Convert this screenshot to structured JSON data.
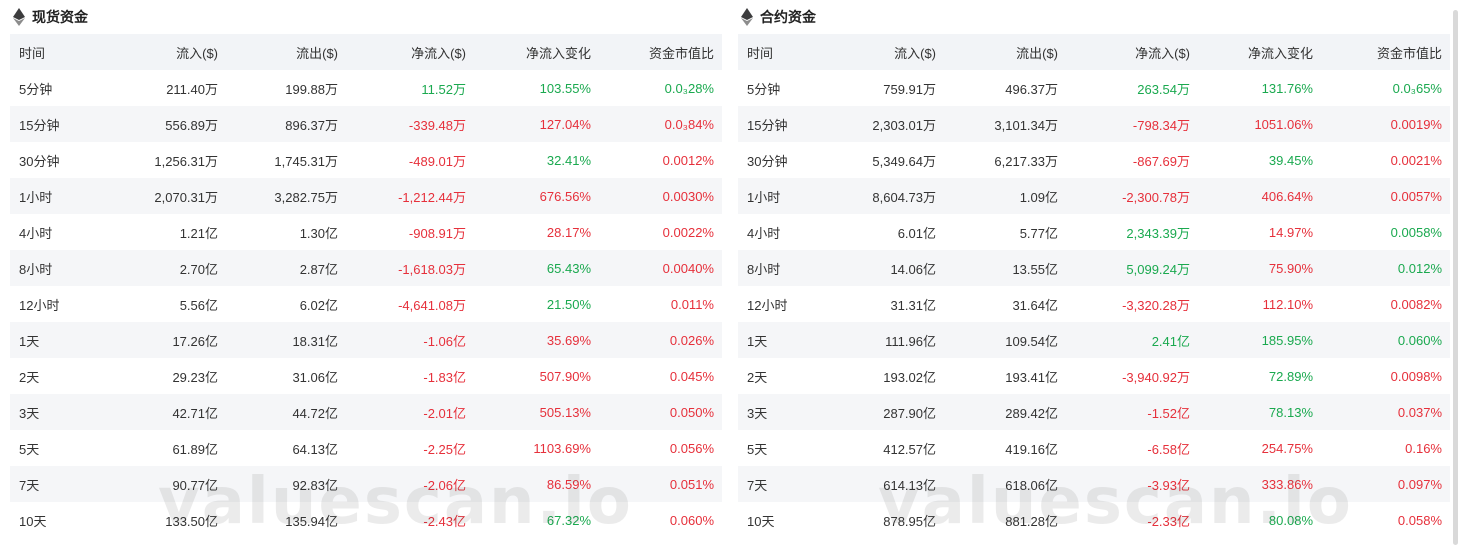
{
  "colors": {
    "positive": "#1aa94f",
    "negative": "#e6303b",
    "header_bg": "#f2f4f7"
  },
  "watermark": "valuescan.io",
  "columns": [
    "时间",
    "流入($)",
    "流出($)",
    "净流入($)",
    "净流入变化",
    "资金市值比"
  ],
  "spot": {
    "title": "现货资金",
    "icon": "ethereum-icon",
    "rows": [
      {
        "t": "5分钟",
        "in": "211.40万",
        "out": "199.88万",
        "net": "11.52万",
        "net_s": "pos",
        "chg": "103.55%",
        "chg_s": "pos",
        "ratio": "0.0₃28%",
        "ratio_s": "pos"
      },
      {
        "t": "15分钟",
        "in": "556.89万",
        "out": "896.37万",
        "net": "-339.48万",
        "net_s": "neg",
        "chg": "127.04%",
        "chg_s": "neg",
        "ratio": "0.0₃84%",
        "ratio_s": "neg"
      },
      {
        "t": "30分钟",
        "in": "1,256.31万",
        "out": "1,745.31万",
        "net": "-489.01万",
        "net_s": "neg",
        "chg": "32.41%",
        "chg_s": "pos",
        "ratio": "0.0012%",
        "ratio_s": "neg"
      },
      {
        "t": "1小时",
        "in": "2,070.31万",
        "out": "3,282.75万",
        "net": "-1,212.44万",
        "net_s": "neg",
        "chg": "676.56%",
        "chg_s": "neg",
        "ratio": "0.0030%",
        "ratio_s": "neg"
      },
      {
        "t": "4小时",
        "in": "1.21亿",
        "out": "1.30亿",
        "net": "-908.91万",
        "net_s": "neg",
        "chg": "28.17%",
        "chg_s": "neg",
        "ratio": "0.0022%",
        "ratio_s": "neg"
      },
      {
        "t": "8小时",
        "in": "2.70亿",
        "out": "2.87亿",
        "net": "-1,618.03万",
        "net_s": "neg",
        "chg": "65.43%",
        "chg_s": "pos",
        "ratio": "0.0040%",
        "ratio_s": "neg"
      },
      {
        "t": "12小时",
        "in": "5.56亿",
        "out": "6.02亿",
        "net": "-4,641.08万",
        "net_s": "neg",
        "chg": "21.50%",
        "chg_s": "pos",
        "ratio": "0.011%",
        "ratio_s": "neg"
      },
      {
        "t": "1天",
        "in": "17.26亿",
        "out": "18.31亿",
        "net": "-1.06亿",
        "net_s": "neg",
        "chg": "35.69%",
        "chg_s": "neg",
        "ratio": "0.026%",
        "ratio_s": "neg"
      },
      {
        "t": "2天",
        "in": "29.23亿",
        "out": "31.06亿",
        "net": "-1.83亿",
        "net_s": "neg",
        "chg": "507.90%",
        "chg_s": "neg",
        "ratio": "0.045%",
        "ratio_s": "neg"
      },
      {
        "t": "3天",
        "in": "42.71亿",
        "out": "44.72亿",
        "net": "-2.01亿",
        "net_s": "neg",
        "chg": "505.13%",
        "chg_s": "neg",
        "ratio": "0.050%",
        "ratio_s": "neg"
      },
      {
        "t": "5天",
        "in": "61.89亿",
        "out": "64.13亿",
        "net": "-2.25亿",
        "net_s": "neg",
        "chg": "1103.69%",
        "chg_s": "neg",
        "ratio": "0.056%",
        "ratio_s": "neg"
      },
      {
        "t": "7天",
        "in": "90.77亿",
        "out": "92.83亿",
        "net": "-2.06亿",
        "net_s": "neg",
        "chg": "86.59%",
        "chg_s": "neg",
        "ratio": "0.051%",
        "ratio_s": "neg"
      },
      {
        "t": "10天",
        "in": "133.50亿",
        "out": "135.94亿",
        "net": "-2.43亿",
        "net_s": "neg",
        "chg": "67.32%",
        "chg_s": "pos",
        "ratio": "0.060%",
        "ratio_s": "neg"
      }
    ]
  },
  "futures": {
    "title": "合约资金",
    "icon": "ethereum-icon",
    "rows": [
      {
        "t": "5分钟",
        "in": "759.91万",
        "out": "496.37万",
        "net": "263.54万",
        "net_s": "pos",
        "chg": "131.76%",
        "chg_s": "pos",
        "ratio": "0.0₃65%",
        "ratio_s": "pos"
      },
      {
        "t": "15分钟",
        "in": "2,303.01万",
        "out": "3,101.34万",
        "net": "-798.34万",
        "net_s": "neg",
        "chg": "1051.06%",
        "chg_s": "neg",
        "ratio": "0.0019%",
        "ratio_s": "neg"
      },
      {
        "t": "30分钟",
        "in": "5,349.64万",
        "out": "6,217.33万",
        "net": "-867.69万",
        "net_s": "neg",
        "chg": "39.45%",
        "chg_s": "pos",
        "ratio": "0.0021%",
        "ratio_s": "neg"
      },
      {
        "t": "1小时",
        "in": "8,604.73万",
        "out": "1.09亿",
        "net": "-2,300.78万",
        "net_s": "neg",
        "chg": "406.64%",
        "chg_s": "neg",
        "ratio": "0.0057%",
        "ratio_s": "neg"
      },
      {
        "t": "4小时",
        "in": "6.01亿",
        "out": "5.77亿",
        "net": "2,343.39万",
        "net_s": "pos",
        "chg": "14.97%",
        "chg_s": "neg",
        "ratio": "0.0058%",
        "ratio_s": "pos"
      },
      {
        "t": "8小时",
        "in": "14.06亿",
        "out": "13.55亿",
        "net": "5,099.24万",
        "net_s": "pos",
        "chg": "75.90%",
        "chg_s": "neg",
        "ratio": "0.012%",
        "ratio_s": "pos"
      },
      {
        "t": "12小时",
        "in": "31.31亿",
        "out": "31.64亿",
        "net": "-3,320.28万",
        "net_s": "neg",
        "chg": "112.10%",
        "chg_s": "neg",
        "ratio": "0.0082%",
        "ratio_s": "neg"
      },
      {
        "t": "1天",
        "in": "111.96亿",
        "out": "109.54亿",
        "net": "2.41亿",
        "net_s": "pos",
        "chg": "185.95%",
        "chg_s": "pos",
        "ratio": "0.060%",
        "ratio_s": "pos"
      },
      {
        "t": "2天",
        "in": "193.02亿",
        "out": "193.41亿",
        "net": "-3,940.92万",
        "net_s": "neg",
        "chg": "72.89%",
        "chg_s": "pos",
        "ratio": "0.0098%",
        "ratio_s": "neg"
      },
      {
        "t": "3天",
        "in": "287.90亿",
        "out": "289.42亿",
        "net": "-1.52亿",
        "net_s": "neg",
        "chg": "78.13%",
        "chg_s": "pos",
        "ratio": "0.037%",
        "ratio_s": "neg"
      },
      {
        "t": "5天",
        "in": "412.57亿",
        "out": "419.16亿",
        "net": "-6.58亿",
        "net_s": "neg",
        "chg": "254.75%",
        "chg_s": "neg",
        "ratio": "0.16%",
        "ratio_s": "neg"
      },
      {
        "t": "7天",
        "in": "614.13亿",
        "out": "618.06亿",
        "net": "-3.93亿",
        "net_s": "neg",
        "chg": "333.86%",
        "chg_s": "neg",
        "ratio": "0.097%",
        "ratio_s": "neg"
      },
      {
        "t": "10天",
        "in": "878.95亿",
        "out": "881.28亿",
        "net": "-2.33亿",
        "net_s": "neg",
        "chg": "80.08%",
        "chg_s": "pos",
        "ratio": "0.058%",
        "ratio_s": "neg"
      }
    ]
  }
}
